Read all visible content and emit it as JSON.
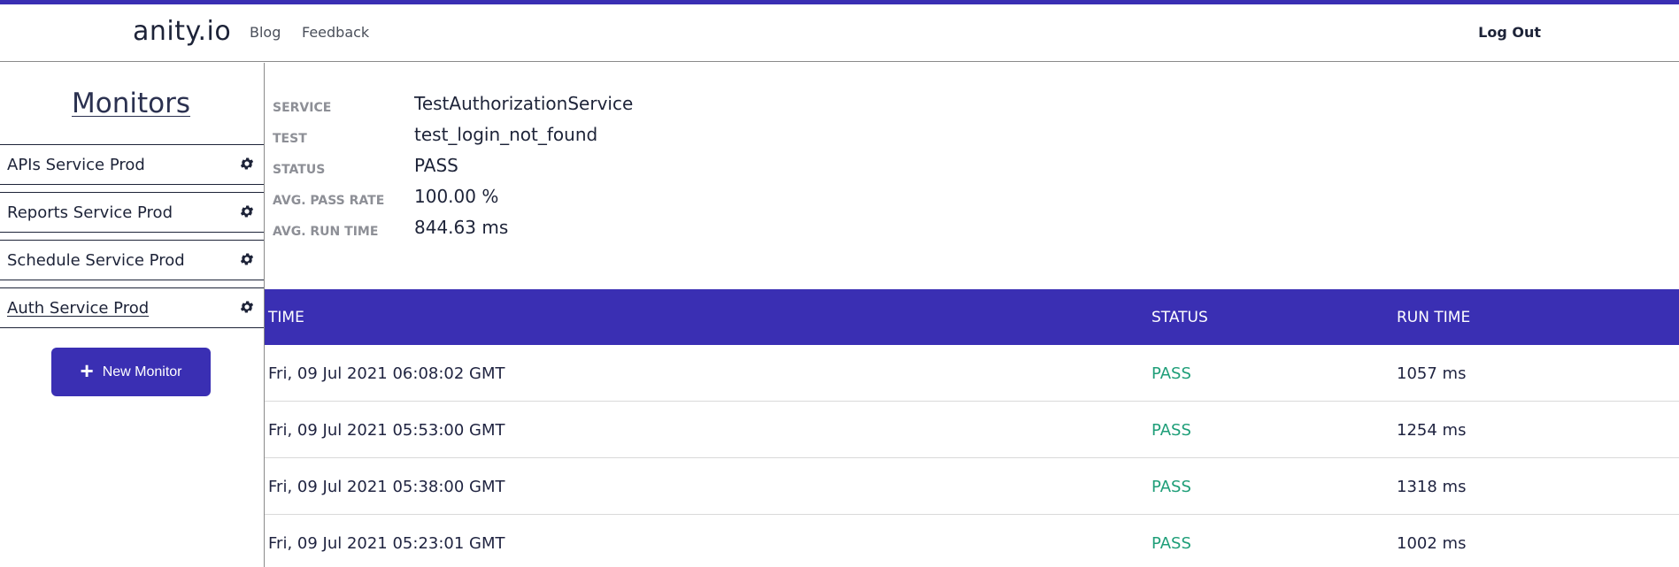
{
  "header": {
    "logo": "anity.io",
    "nav": [
      "Blog",
      "Feedback"
    ],
    "logout_label": "Log Out"
  },
  "sidebar": {
    "title": "Monitors",
    "monitors": [
      {
        "label": "APIs Service Prod",
        "icon": "gear-icon",
        "active": false
      },
      {
        "label": "Reports Service Prod",
        "icon": "gear-icon",
        "active": false
      },
      {
        "label": "Schedule Service Prod",
        "icon": "gear-icon",
        "active": false
      },
      {
        "label": "Auth Service Prod",
        "icon": "gear-icon",
        "active": true
      }
    ],
    "new_monitor_label": "New Monitor",
    "new_monitor_icon": "plus-icon"
  },
  "details": [
    {
      "key": "SERVICE",
      "value": "TestAuthorizationService"
    },
    {
      "key": "TEST",
      "value": "test_login_not_found"
    },
    {
      "key": "STATUS",
      "value": "PASS"
    },
    {
      "key": "AVG. PASS RATE",
      "value": "100.00 %"
    },
    {
      "key": "AVG. RUN TIME",
      "value": "844.63 ms"
    }
  ],
  "table": {
    "columns": [
      "TIME",
      "STATUS",
      "RUN TIME"
    ],
    "rows": [
      {
        "time": "Fri, 09 Jul 2021 06:08:02 GMT",
        "status": "PASS",
        "run_time": "1057 ms"
      },
      {
        "time": "Fri, 09 Jul 2021 05:53:00 GMT",
        "status": "PASS",
        "run_time": "1254 ms"
      },
      {
        "time": "Fri, 09 Jul 2021 05:38:00 GMT",
        "status": "PASS",
        "run_time": "1318 ms"
      },
      {
        "time": "Fri, 09 Jul 2021 05:23:01 GMT",
        "status": "PASS",
        "run_time": "1002 ms"
      }
    ]
  },
  "colors": {
    "accent": "#3a2fb3",
    "pass": "#1e9e78",
    "text": "#1d2338"
  }
}
